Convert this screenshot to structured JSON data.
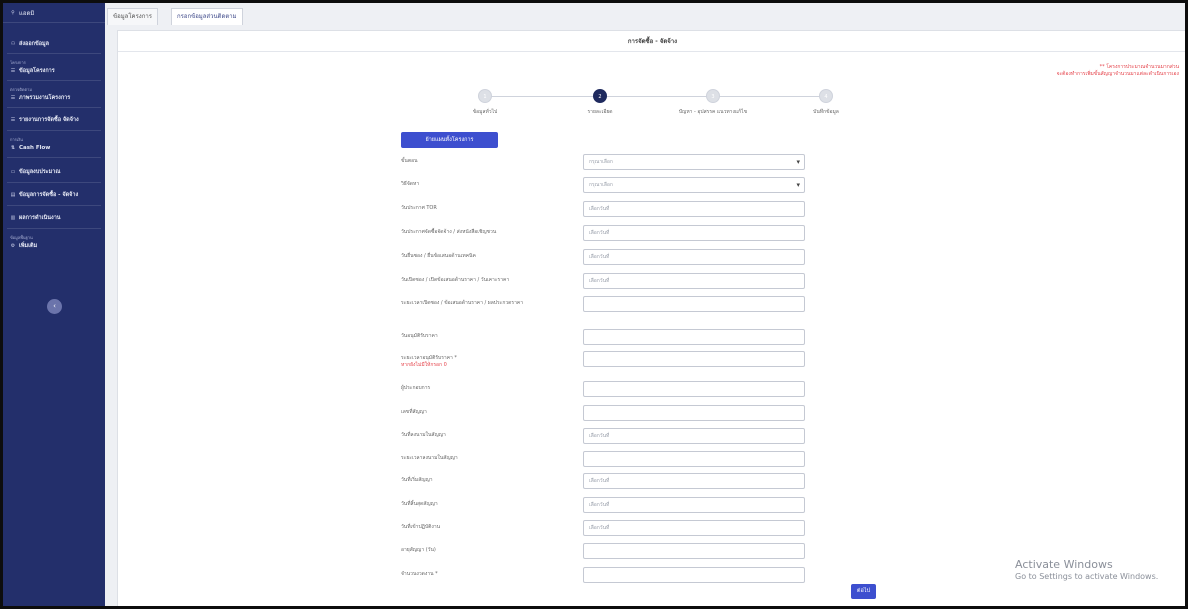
{
  "sidebar": {
    "user_label": "แอดมิ",
    "menu_main": "ส่งออกข้อมูล",
    "section_project": "โครงการ",
    "item_project_info": "ข้อมูลโครงการ",
    "section_monitor": "ตรวจติดตาม",
    "item_project_overview": "ภาพรวมงานโครงการ",
    "item_procurement_list": "รายงานการจัดซื้อ จัดจ้าง",
    "section_finance": "การเงิน",
    "item_cashflow": "Cash Flow",
    "item_budget": "ข้อมูลงบประมาณ",
    "item_procurement_info": "ข้อมูลการจัดซื้อ - จัดจ้าง",
    "item_performance": "ผลการดำเนินงาน",
    "section_settings": "ข้อมูลพื้นฐาน",
    "item_add": "เพิ่มเติม",
    "collapse_label": "‹"
  },
  "tabs": {
    "tab1": "ข้อมูลโครงการ",
    "tab2": "กรอกข้อมูลส่วนติดตาม"
  },
  "card": {
    "title": "การจัดซื้อ - จัดจ้าง",
    "note_line1": "** โครงการประมาณจำนวนมากส่วน",
    "note_line2": "จะต้องทำการเพิ่มขั้นสัญญาจำนวนมาแต่ละดำเนินการเอง"
  },
  "stepper": {
    "steps": [
      {
        "num": "1",
        "label": "ข้อมูลทั่วไป",
        "active": false
      },
      {
        "num": "2",
        "label": "รายละเอียด",
        "active": true
      },
      {
        "num": "3",
        "label": "ปัญหา - อุปสรรค แนวทางแก้ไข",
        "active": false
      },
      {
        "num": "4",
        "label": "บันทึกข้อมูล",
        "active": false
      }
    ]
  },
  "form": {
    "top_button": "ย้ายแผนทั้งโครงการ",
    "select_placeholder": "กรุณาเลือก",
    "date_placeholder": "เลือกวันที่",
    "rows": [
      {
        "label": "ขั้นตอน",
        "kind": "select"
      },
      {
        "label": "วิธีจัดหา",
        "kind": "select"
      },
      {
        "label": "วันประกาศ TOR",
        "kind": "date"
      },
      {
        "label": "วันประกาศจัดซื้อจัดจ้าง / ส่งหนังสือเชิญชวน",
        "kind": "date"
      },
      {
        "label": "วันยื่นซอง / ยื่นข้อเสนอด้านเทคนิค",
        "kind": "date"
      },
      {
        "label": "วันเปิดซอง / เปิดข้อเสนอด้านราคา / วันเคาะราคา",
        "kind": "date"
      },
      {
        "label": "ระยะเวลาเปิดซอง / ข้อเสนอด้านราคา / ผลประกวดราคา",
        "kind": "text"
      },
      {
        "label": "วันอนุมัติรับราคา",
        "kind": "text"
      },
      {
        "label": "ระยะเวลาอนุมัติรับราคา *",
        "label2": "หากยังไม่มีให้กรอก 0",
        "kind": "text"
      },
      {
        "label": "ผู้ประกอบการ",
        "kind": "text"
      },
      {
        "label": "เลขที่สัญญา",
        "kind": "text"
      },
      {
        "label": "วันที่ลงนามในสัญญา",
        "kind": "date"
      },
      {
        "label": "ระยะเวลาลงนามในสัญญา",
        "kind": "text"
      },
      {
        "label": "วันที่เริ่มสัญญา",
        "kind": "date"
      },
      {
        "label": "วันที่สิ้นสุดสัญญา",
        "kind": "date"
      },
      {
        "label": "วันที่เข้าปฏิบัติงาน",
        "kind": "date"
      },
      {
        "label": "อายุสัญญา (วัน)",
        "kind": "text"
      },
      {
        "label": "จำนวนงวดงาน *",
        "kind": "text"
      }
    ],
    "next_button": "ต่อไป"
  },
  "watermark": {
    "line1": "Activate Windows",
    "line2": "Go to Settings to activate Windows."
  }
}
